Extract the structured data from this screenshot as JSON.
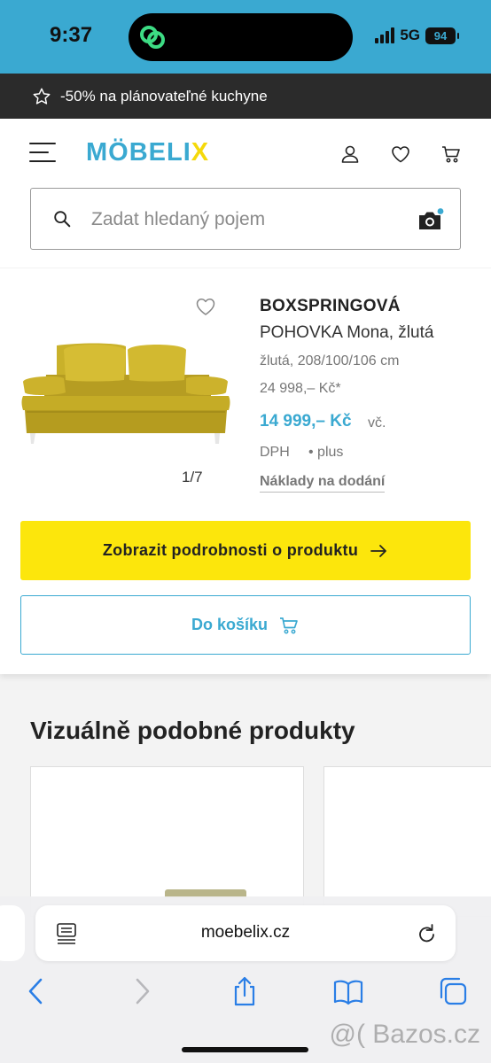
{
  "status_bar": {
    "time": "9:37",
    "network": "5G",
    "battery": "94"
  },
  "promo": {
    "text": "-50% na plánovateľné kuchyne",
    "icon": "star-icon"
  },
  "header": {
    "logo_main": "MÖBELI",
    "logo_accent": "X",
    "icons": [
      "menu-icon",
      "user-icon",
      "heart-icon",
      "cart-icon"
    ],
    "search": {
      "placeholder": "Zadat hledaný pojem"
    }
  },
  "product": {
    "title": "BOXSPRINGOVÁ",
    "subtitle": "POHOVKA Mona, žlutá",
    "spec": "žlutá, 208/100/106 cm",
    "old_price": "24 998,– Kč*",
    "price": "14 999,– Kč",
    "vat_prefix": "vč.",
    "vat": "DPH",
    "plus": "• plus",
    "delivery": "Náklady na dodání",
    "image_counter": "1/7",
    "details_button": "Zobrazit podrobnosti o produktu",
    "cart_button": "Do košíku"
  },
  "similar": {
    "title": "Vizuálně podobné produkty"
  },
  "browser": {
    "url": "moebelix.cz"
  },
  "watermark": "@( Bazos.cz",
  "colors": {
    "accent": "#3aa9d1",
    "yellow": "#fce60c",
    "dark": "#2b2b2b"
  }
}
